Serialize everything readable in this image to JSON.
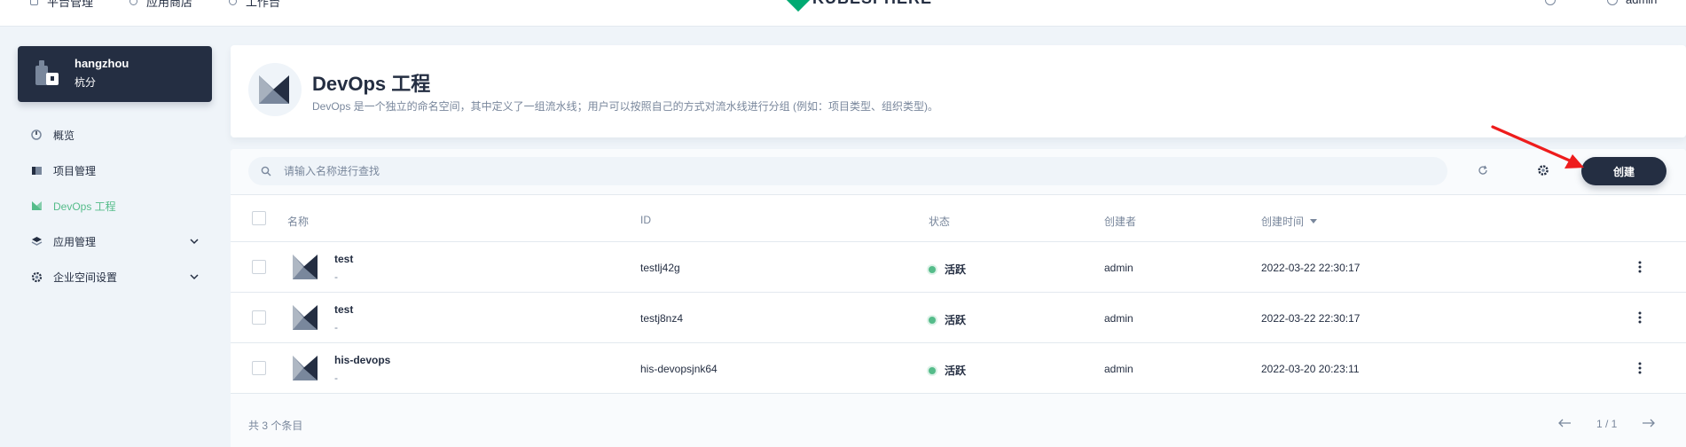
{
  "top_nav": {
    "items": [
      "平台管理",
      "应用商店",
      "工作台"
    ],
    "logo_text": "KUBESPHERE",
    "user": "admin"
  },
  "workspace": {
    "name": "hangzhou",
    "description": "杭分"
  },
  "side_menu": {
    "items": [
      {
        "label": "概览",
        "icon": "dashboard-icon",
        "active": false
      },
      {
        "label": "项目管理",
        "icon": "project-icon",
        "active": false
      },
      {
        "label": "DevOps 工程",
        "icon": "devops-icon",
        "active": true
      },
      {
        "label": "应用管理",
        "icon": "appstore-icon",
        "active": false,
        "expandable": true
      },
      {
        "label": "企业空间设置",
        "icon": "gear-icon",
        "active": false,
        "expandable": true
      }
    ]
  },
  "header": {
    "title": "DevOps 工程",
    "description": "DevOps 是一个独立的命名空间，其中定义了一组流水线；用户可以按照自己的方式对流水线进行分组 (例如：项目类型、组织类型)。"
  },
  "toolbar": {
    "search_placeholder": "请输入名称进行查找",
    "create_label": "创建"
  },
  "table": {
    "columns": {
      "name": "名称",
      "id": "ID",
      "status": "状态",
      "creator": "创建者",
      "created_time": "创建时间"
    },
    "rows": [
      {
        "name": "test",
        "desc": "-",
        "id": "testlj42g",
        "status": "活跃",
        "creator": "admin",
        "created_time": "2022-03-22 22:30:17"
      },
      {
        "name": "test",
        "desc": "-",
        "id": "testj8nz4",
        "status": "活跃",
        "creator": "admin",
        "created_time": "2022-03-22 22:30:17"
      },
      {
        "name": "his-devops",
        "desc": "-",
        "id": "his-devopsjnk64",
        "status": "活跃",
        "creator": "admin",
        "created_time": "2022-03-20 20:23:11"
      }
    ]
  },
  "footer": {
    "total": "共 3 个条目",
    "page_info": "1 / 1"
  },
  "colors": {
    "accent_green": "#55bc8a",
    "dark": "#242e42",
    "annotation_red": "#ee1c1c"
  }
}
